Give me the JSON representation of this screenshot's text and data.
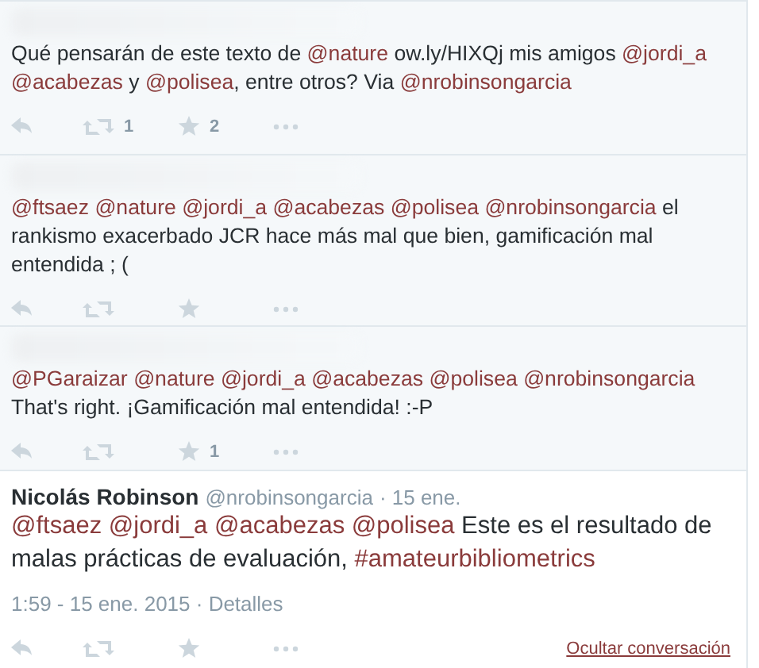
{
  "tweets": [
    {
      "segments": [
        {
          "kind": "plain",
          "text": "Qué pensarán de este texto de "
        },
        {
          "kind": "mention",
          "text": "@nature"
        },
        {
          "kind": "plain",
          "text": " ow.ly/HIXQj mis amigos "
        },
        {
          "kind": "mention",
          "text": "@jordi_a"
        },
        {
          "kind": "mention",
          "text": "@acabezas"
        },
        {
          "kind": "plain",
          "text": " y "
        },
        {
          "kind": "mention",
          "text": "@polisea"
        },
        {
          "kind": "plain",
          "text": ", entre otros? Via "
        },
        {
          "kind": "mention",
          "text": "@nrobinsongarcia"
        }
      ],
      "retweets": "1",
      "favorites": "2"
    },
    {
      "segments": [
        {
          "kind": "mention",
          "text": "@ftsaez"
        },
        {
          "kind": "mention",
          "text": "@nature"
        },
        {
          "kind": "mention",
          "text": "@jordi_a"
        },
        {
          "kind": "mention",
          "text": "@acabezas"
        },
        {
          "kind": "mention",
          "text": "@polisea"
        },
        {
          "kind": "mention",
          "text": "@nrobinsongarcia"
        },
        {
          "kind": "plain",
          "text": " el rankismo exacerbado JCR hace más mal que bien, gamificación mal entendida ; ("
        }
      ]
    },
    {
      "segments": [
        {
          "kind": "mention",
          "text": "@PGaraizar"
        },
        {
          "kind": "mention",
          "text": "@nature"
        },
        {
          "kind": "mention",
          "text": "@jordi_a"
        },
        {
          "kind": "mention",
          "text": "@acabezas"
        },
        {
          "kind": "mention",
          "text": "@polisea"
        },
        {
          "kind": "mention",
          "text": "@nrobinsongarcia"
        },
        {
          "kind": "plain",
          "text": " That's right. ¡Gamificación mal entendida! :-P"
        }
      ],
      "favorites": "1"
    },
    {
      "selected": true,
      "author": {
        "name": "Nicolás Robinson",
        "handle": "@nrobinsongarcia",
        "date": "· 15 ene."
      },
      "segments": [
        {
          "kind": "mention",
          "text": "@ftsaez"
        },
        {
          "kind": "mention",
          "text": "@jordi_a"
        },
        {
          "kind": "mention",
          "text": "@acabezas"
        },
        {
          "kind": "mention",
          "text": "@polisea"
        },
        {
          "kind": "plain",
          "text": " Este es el resultado de malas prácticas de evaluación, "
        },
        {
          "kind": "mention",
          "text": "#amateurbibliometrics"
        }
      ],
      "timestamp": "1:59 - 15 ene. 2015 · Detalles",
      "collapse_link": "Ocultar conversación"
    }
  ]
}
